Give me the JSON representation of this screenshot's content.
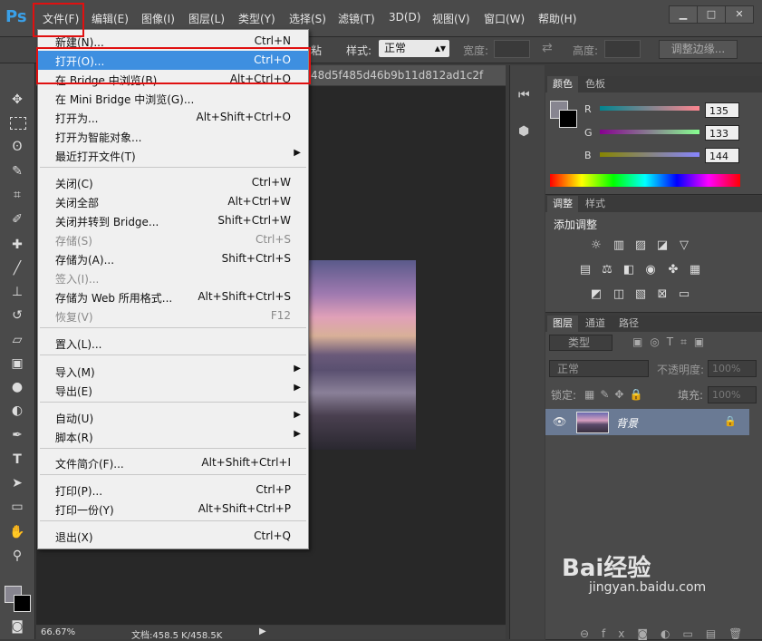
{
  "app": {
    "logo": "Ps"
  },
  "menubar": {
    "items": [
      "文件(F)",
      "编辑(E)",
      "图像(I)",
      "图层(L)",
      "类型(Y)",
      "选择(S)",
      "滤镜(T)",
      "3D(D)",
      "视图(V)",
      "窗口(W)",
      "帮助(H)"
    ],
    "window_buttons": [
      "▁",
      "□",
      "✕"
    ]
  },
  "options_bar": {
    "partial_text": "粘",
    "style_label": "样式:",
    "style_value": "正常",
    "width_label": "宽度:",
    "height_label": "高度:",
    "refine_button": "调整边缘..."
  },
  "document": {
    "tab_partial": "48d5f485d46b9b11d812ad1c2f",
    "zoom": "66.67%",
    "doc_size": "文档:458.5 K/458.5K"
  },
  "file_menu": {
    "items": [
      {
        "label": "新建(N)...",
        "shortcut": "Ctrl+N",
        "state": "normal"
      },
      {
        "label": "打开(O)...",
        "shortcut": "Ctrl+O",
        "state": "highlighted"
      },
      {
        "label": "在 Bridge 中浏览(B)...",
        "shortcut": "Alt+Ctrl+O",
        "state": "normal"
      },
      {
        "label": "在 Mini Bridge 中浏览(G)...",
        "shortcut": "",
        "state": "normal"
      },
      {
        "label": "打开为...",
        "shortcut": "Alt+Shift+Ctrl+O",
        "state": "normal"
      },
      {
        "label": "打开为智能对象...",
        "shortcut": "",
        "state": "normal"
      },
      {
        "label": "最近打开文件(T)",
        "shortcut": "",
        "state": "submenu"
      },
      {
        "label": "关闭(C)",
        "shortcut": "Ctrl+W",
        "state": "normal"
      },
      {
        "label": "关闭全部",
        "shortcut": "Alt+Ctrl+W",
        "state": "normal"
      },
      {
        "label": "关闭并转到 Bridge...",
        "shortcut": "Shift+Ctrl+W",
        "state": "normal"
      },
      {
        "label": "存储(S)",
        "shortcut": "Ctrl+S",
        "state": "disabled"
      },
      {
        "label": "存储为(A)...",
        "shortcut": "Shift+Ctrl+S",
        "state": "normal"
      },
      {
        "label": "签入(I)...",
        "shortcut": "",
        "state": "disabled"
      },
      {
        "label": "存储为 Web 所用格式...",
        "shortcut": "Alt+Shift+Ctrl+S",
        "state": "normal"
      },
      {
        "label": "恢复(V)",
        "shortcut": "F12",
        "state": "disabled"
      },
      {
        "label": "置入(L)...",
        "shortcut": "",
        "state": "normal"
      },
      {
        "label": "导入(M)",
        "shortcut": "",
        "state": "submenu"
      },
      {
        "label": "导出(E)",
        "shortcut": "",
        "state": "submenu"
      },
      {
        "label": "自动(U)",
        "shortcut": "",
        "state": "submenu"
      },
      {
        "label": "脚本(R)",
        "shortcut": "",
        "state": "submenu"
      },
      {
        "label": "文件简介(F)...",
        "shortcut": "Alt+Shift+Ctrl+I",
        "state": "normal"
      },
      {
        "label": "打印(P)...",
        "shortcut": "Ctrl+P",
        "state": "normal"
      },
      {
        "label": "打印一份(Y)",
        "shortcut": "Alt+Shift+Ctrl+P",
        "state": "normal"
      },
      {
        "label": "退出(X)",
        "shortcut": "Ctrl+Q",
        "state": "normal"
      }
    ]
  },
  "color_panel": {
    "tabs": [
      "颜色",
      "色板"
    ],
    "channels": [
      {
        "name": "R",
        "value": "135"
      },
      {
        "name": "G",
        "value": "133"
      },
      {
        "name": "B",
        "value": "144"
      }
    ]
  },
  "adjust_panel": {
    "tabs": [
      "调整",
      "样式"
    ],
    "title": "添加调整"
  },
  "layers_panel": {
    "tabs": [
      "图层",
      "通道",
      "路径"
    ],
    "filter_label": "类型",
    "blend_mode": "正常",
    "opacity_label": "不透明度:",
    "opacity_value": "100%",
    "lock_label": "锁定:",
    "fill_label": "填充:",
    "fill_value": "100%",
    "layer_name": "背景"
  },
  "watermark": {
    "brand": "Bai经验",
    "url": "jingyan.baidu.com"
  },
  "colors": {
    "highlight": "#3e8fe0",
    "annotation": "#e01010",
    "ps_blue": "#3aa0e8"
  }
}
